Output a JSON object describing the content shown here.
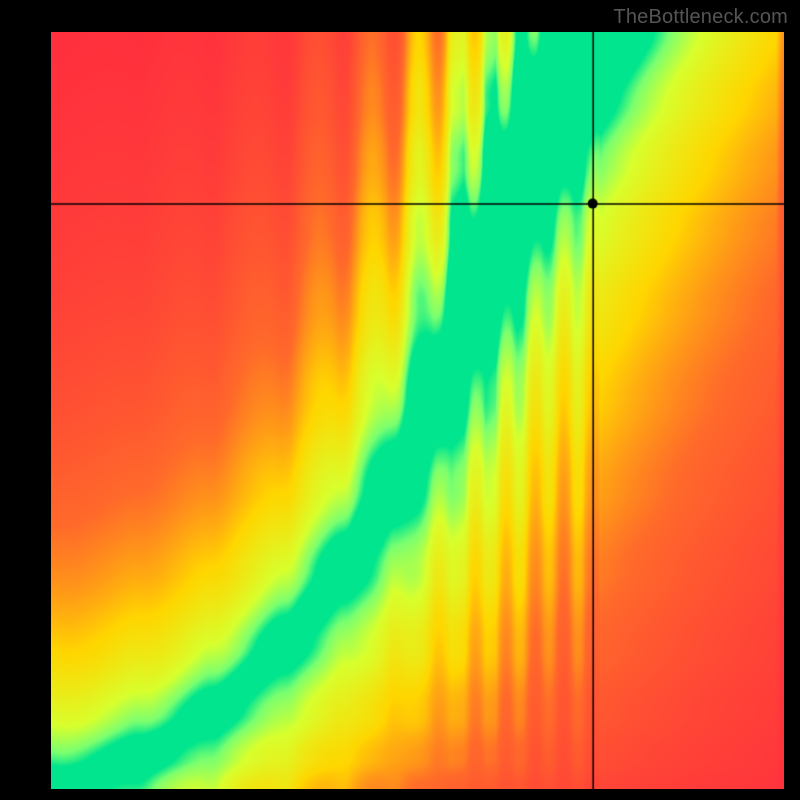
{
  "watermark": "TheBottleneck.com",
  "chart_data": {
    "type": "heatmap",
    "title": "",
    "xlabel": "",
    "ylabel": "",
    "xlim": [
      0,
      1
    ],
    "ylim": [
      0,
      1
    ],
    "grid": false,
    "legend": {
      "present": false
    },
    "crosshair": {
      "x_frac": 0.74,
      "y_frac": 0.773
    },
    "marker": {
      "x_frac": 0.74,
      "y_frac": 0.773,
      "radius_px": 5
    },
    "colormap": {
      "name": "red-to-green",
      "stops": [
        {
          "t": 0.0,
          "color": "#ff2a3f"
        },
        {
          "t": 0.3,
          "color": "#ff6a2a"
        },
        {
          "t": 0.55,
          "color": "#ffd600"
        },
        {
          "t": 0.8,
          "color": "#d8ff2d"
        },
        {
          "t": 0.93,
          "color": "#7aff70"
        },
        {
          "t": 1.0,
          "color": "#00e58e"
        }
      ]
    },
    "ridge": {
      "description": "curve of best-match (fitness=1) running from bottom-left to top center-right, steepening sharply",
      "control_points": [
        {
          "x": 0.0,
          "y": 0.0
        },
        {
          "x": 0.12,
          "y": 0.04
        },
        {
          "x": 0.22,
          "y": 0.1
        },
        {
          "x": 0.32,
          "y": 0.19
        },
        {
          "x": 0.4,
          "y": 0.29
        },
        {
          "x": 0.47,
          "y": 0.4
        },
        {
          "x": 0.53,
          "y": 0.52
        },
        {
          "x": 0.58,
          "y": 0.64
        },
        {
          "x": 0.62,
          "y": 0.74
        },
        {
          "x": 0.66,
          "y": 0.83
        },
        {
          "x": 0.7,
          "y": 0.91
        },
        {
          "x": 0.74,
          "y": 1.0
        }
      ],
      "half_width_frac_bottom": 0.02,
      "half_width_frac_top": 0.11,
      "falloff_scale_frac": 0.55
    },
    "annotations": []
  }
}
